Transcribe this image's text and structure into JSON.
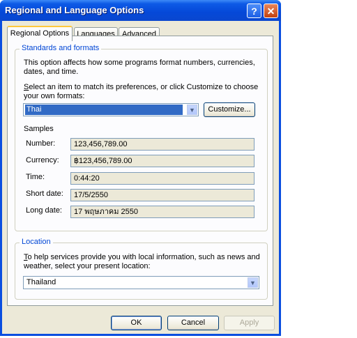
{
  "window": {
    "title": "Regional and Language Options",
    "help_glyph": "?",
    "close_glyph": "✕"
  },
  "tabs": [
    {
      "label": "Regional Options",
      "active": true
    },
    {
      "label": "Languages",
      "active": false
    },
    {
      "label": "Advanced",
      "active": false
    }
  ],
  "standards": {
    "group_title": "Standards and formats",
    "description": "This option affects how some programs format numbers, currencies, dates, and time.",
    "instruction_first": "S",
    "instruction_rest": "elect an item to match its preferences, or click Customize to choose your own formats:",
    "format_value": "Thai",
    "customize_label": "Customize...",
    "samples_label": "Samples",
    "samples": [
      {
        "label": "Number:",
        "value": "123,456,789.00"
      },
      {
        "label": "Currency:",
        "value": "฿123,456,789.00"
      },
      {
        "label": "Time:",
        "value": "0:44:20"
      },
      {
        "label": "Short date:",
        "value": "17/5/2550"
      },
      {
        "label": "Long date:",
        "value": "17 พฤษภาคม 2550"
      }
    ]
  },
  "location": {
    "group_title": "Location",
    "instruction_first": "T",
    "instruction_rest": "o help services provide you with local information, such as news and weather, select your present location:",
    "value": "Thailand"
  },
  "buttons": {
    "ok": "OK",
    "cancel": "Cancel",
    "apply": "Apply"
  },
  "colors": {
    "titlebar": "#0a4ee0",
    "group_title": "#0046d5",
    "selection": "#316ac5",
    "dialog_bg": "#ece9d8"
  }
}
